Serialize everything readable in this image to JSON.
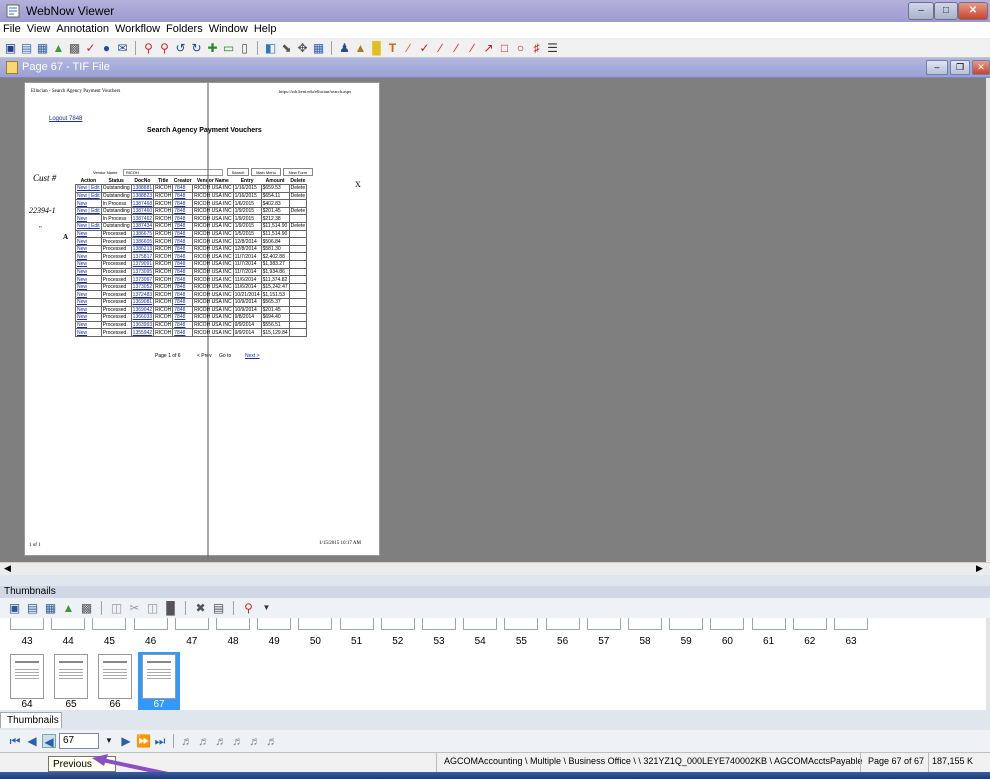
{
  "window": {
    "title": "WebNow Viewer"
  },
  "menu": [
    "File",
    "View",
    "Annotation",
    "Workflow",
    "Folders",
    "Window",
    "Help"
  ],
  "document": {
    "title": "Page 67 - TIF File"
  },
  "page": {
    "header_left": "Ellucian - Search Agency Payment Vouchers",
    "header_right": "https://ssb.kent.edu/ellucian/search.aspx",
    "logout": "Logout 7848",
    "heading": "Search Agency Payment Vouchers",
    "form": {
      "vendor_label": "Vendor Name",
      "vendor_value": "RICOH",
      "btn_search": "Search",
      "btn_main": "Main Menu",
      "btn_new": "New Form"
    },
    "columns": [
      "Action",
      "Status",
      "DocNo",
      "Title",
      "Creator",
      "Vendor Name",
      "Entry",
      "Amount",
      "Delete"
    ],
    "rows": [
      [
        "New | Edit",
        "Outstanding",
        "1388881",
        "RICOH",
        "7848",
        "RICOH USA INC",
        "1/16/2015",
        "$659.53",
        "Delete"
      ],
      [
        "New | Edit",
        "Outstanding",
        "1388823",
        "RICOH",
        "7848",
        "RICOH USA INC",
        "1/16/2015",
        "$654.11",
        "Delete"
      ],
      [
        "New",
        "In Process",
        "1387468",
        "RICOH",
        "7848",
        "RICOH USA INC",
        "1/6/2015",
        "$402.83",
        ""
      ],
      [
        "New | Edit",
        "Outstanding",
        "1387460",
        "RICOH",
        "7848",
        "RICOH USA INC",
        "1/9/2015",
        "$201.45",
        "Delete"
      ],
      [
        "New",
        "In Process",
        "1387462",
        "RICOH",
        "7848",
        "RICOH USA INC",
        "1/9/2015",
        "$212.38",
        ""
      ],
      [
        "New | Edit",
        "Outstanding",
        "1387434",
        "RICOH",
        "7848",
        "RICOH USA INC",
        "1/9/2015",
        "$11,514.90",
        "Delete"
      ],
      [
        "New",
        "Processed",
        "1386675",
        "RICOH",
        "7848",
        "RICOH USA INC",
        "1/5/2015",
        "$11,514.90",
        ""
      ],
      [
        "New",
        "Processed",
        "1386605",
        "RICOH",
        "7848",
        "RICOH USA INC",
        "12/8/2014",
        "$506.84",
        ""
      ],
      [
        "New",
        "Processed",
        "1386213",
        "RICOH",
        "7848",
        "RICOH USA INC",
        "12/8/2014",
        "$581.30",
        ""
      ],
      [
        "New",
        "Processed",
        "1375817",
        "RICOH",
        "7848",
        "RICOH USA INC",
        "11/7/2014",
        "$2,402.88",
        ""
      ],
      [
        "New",
        "Processed",
        "1379091",
        "RICOH",
        "7848",
        "RICOH USA INC",
        "11/7/2014",
        "$1,383.27",
        ""
      ],
      [
        "New",
        "Processed",
        "1373095",
        "RICOH",
        "7848",
        "RICOH USA INC",
        "11/7/2014",
        "$1,934.86",
        ""
      ],
      [
        "New",
        "Processed",
        "1373067",
        "RICOH",
        "7848",
        "RICOH USA INC",
        "11/6/2014",
        "$11,374.82",
        ""
      ],
      [
        "New",
        "Processed",
        "1373052",
        "RICOH",
        "7848",
        "RICOH USA INC",
        "11/6/2014",
        "$15,242.47",
        ""
      ],
      [
        "New",
        "Processed",
        "1372483",
        "RICOH",
        "7848",
        "RICOH USA INC",
        "10/21/2014",
        "$1,151.53",
        ""
      ],
      [
        "New",
        "Processed",
        "1369081",
        "RICOH",
        "7848",
        "RICOH USA INC",
        "10/9/2014",
        "$565.37",
        ""
      ],
      [
        "New",
        "Processed",
        "1369042",
        "RICOH",
        "7848",
        "RICOH USA INC",
        "10/9/2014",
        "$201.45",
        ""
      ],
      [
        "New",
        "Processed",
        "1366033",
        "RICOH",
        "7848",
        "RICOH USA INC",
        "9/8/2014",
        "$694.40",
        ""
      ],
      [
        "New",
        "Processed",
        "1363993",
        "RICOH",
        "7848",
        "RICOH USA INC",
        "9/9/2014",
        "$556.51",
        ""
      ],
      [
        "New",
        "Processed",
        "1355942",
        "RICOH",
        "7848",
        "RICOH USA INC",
        "9/9/2014",
        "$15,129.84",
        ""
      ]
    ],
    "pager": {
      "page_of": "Page 1 of 6",
      "prev": "< Prev",
      "goto": "Go to",
      "next": "Next >"
    },
    "footer_left": "1 of 1",
    "footer_right": "1/15/2015 10:17 AM",
    "handwritten": [
      "Cust #",
      "22394-1",
      "\"",
      "A",
      "X"
    ]
  },
  "thumbnails": {
    "header": "Thumbnails",
    "top_row": [
      "43",
      "44",
      "45",
      "46",
      "47",
      "48",
      "49",
      "50",
      "51",
      "52",
      "53",
      "54",
      "55",
      "56",
      "57",
      "58",
      "59",
      "60",
      "61",
      "62",
      "63"
    ],
    "bottom_row": [
      "64",
      "65",
      "66",
      "67"
    ],
    "selected": "67",
    "tab_label": "Thumbnails"
  },
  "nav": {
    "page_value": "67"
  },
  "status": {
    "path": "AGCOMAccounting \\ Multiple \\ Business Office \\ \\ 321YZ1Q_000LEYE740002KB \\ AGCOMAcctsPayable",
    "page_info": "Page 67 of 67",
    "size": "187,155 K"
  },
  "tooltip": "Previous",
  "colors": {
    "title_bar": "#a7a3d6",
    "selection": "#3399ff",
    "viewer_bg": "#7f7f7f"
  }
}
